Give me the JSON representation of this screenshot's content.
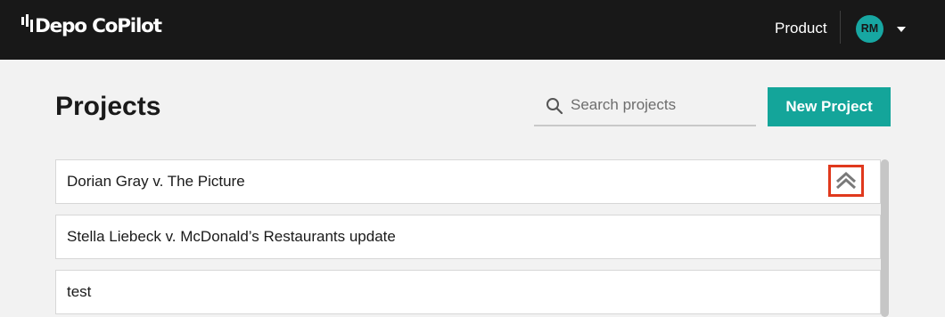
{
  "app": {
    "brand": "Depo CoPilot"
  },
  "nav": {
    "product": "Product",
    "user_initials": "RM"
  },
  "page": {
    "title": "Projects"
  },
  "search": {
    "placeholder": "Search projects",
    "value": ""
  },
  "actions": {
    "new_project": "New Project"
  },
  "projects": [
    {
      "name": "Dorian Gray v. The Picture",
      "expanded": true
    },
    {
      "name": "Stella Liebeck v. McDonald’s Restaurants update"
    },
    {
      "name": "test"
    }
  ],
  "colors": {
    "topbar": "#181818",
    "accent": "#14a59a",
    "avatar": "#17a7a2",
    "highlight": "#e0391d",
    "background": "#f2f2f2"
  },
  "icons": {
    "search": "search-icon",
    "collapse": "double-chevron-up-icon",
    "menu_caret": "caret-down-icon"
  }
}
